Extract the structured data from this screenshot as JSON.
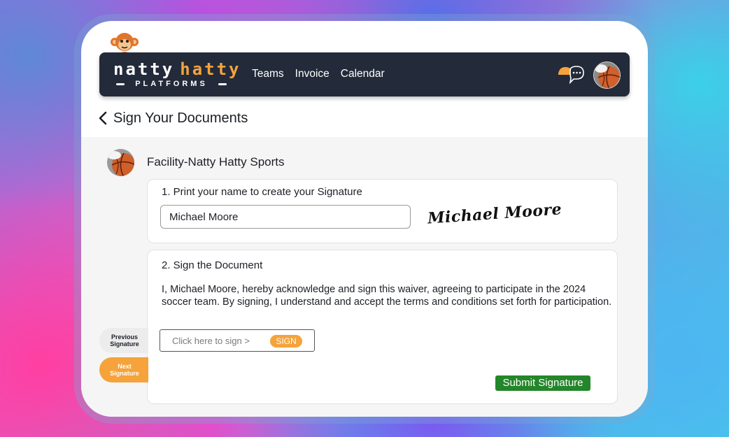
{
  "brand": {
    "word1": "natty",
    "word2": "hatty",
    "subtitle": "PLATFORMS"
  },
  "nav": {
    "links": [
      "Teams",
      "Invoice",
      "Calendar"
    ]
  },
  "icons": {
    "mascot": "monkey-icon",
    "chat": "chat-icon",
    "avatar": "basketball-avatar",
    "back": "chevron-left-icon"
  },
  "page": {
    "title": "Sign Your Documents"
  },
  "facility": {
    "name": "Facility-Natty Hatty Sports"
  },
  "step1": {
    "label": "1. Print your name to create your Signature",
    "name_value": "Michael Moore",
    "signature_preview": "Michael Moore"
  },
  "step2": {
    "label": "2. Sign the Document",
    "waiver_text": "I, Michael Moore, hereby acknowledge and sign this waiver, agreeing to participate in the 2024 soccer team. By signing, I understand and accept the terms and conditions set forth for participation.",
    "sign_hint": "Click here to sign >",
    "sign_badge": "SIGN",
    "submit_label": "Submit Signature"
  },
  "sidebar": {
    "previous_line1": "Previous",
    "previous_line2": "Signature",
    "next_line1": "Next",
    "next_line2": "Signature"
  },
  "colors": {
    "navbar": "#232b3a",
    "accent_orange": "#f5a33a",
    "submit_green": "#24862a"
  }
}
